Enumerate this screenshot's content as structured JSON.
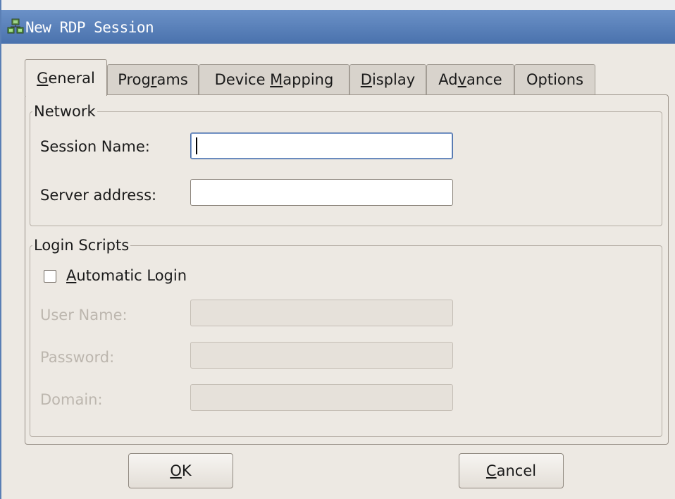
{
  "window": {
    "title": "New RDP Session"
  },
  "tabs": [
    {
      "pre": "",
      "u": "G",
      "post": "eneral",
      "active": true
    },
    {
      "pre": "Prog",
      "u": "r",
      "post": "ams",
      "active": false
    },
    {
      "pre": "Device ",
      "u": "M",
      "post": "apping",
      "active": false
    },
    {
      "pre": "",
      "u": "D",
      "post": "isplay",
      "active": false
    },
    {
      "pre": "Ad",
      "u": "v",
      "post": "ance",
      "active": false
    },
    {
      "pre": "Options",
      "u": "",
      "post": "",
      "active": false
    }
  ],
  "network": {
    "legend": "Network",
    "session_name_label": "Session Name:",
    "session_name_value": "",
    "server_address_label": "Server address:",
    "server_address_value": ""
  },
  "login_scripts": {
    "legend": "Login Scripts",
    "auto_login_u": "A",
    "auto_login_rest": "utomatic Login",
    "auto_login_checked": false,
    "user_name_label": "User Name:",
    "password_label": "Password:",
    "domain_label": "Domain:"
  },
  "buttons": {
    "ok_u": "O",
    "ok_rest": "K",
    "cancel_u": "C",
    "cancel_rest": "ancel"
  }
}
